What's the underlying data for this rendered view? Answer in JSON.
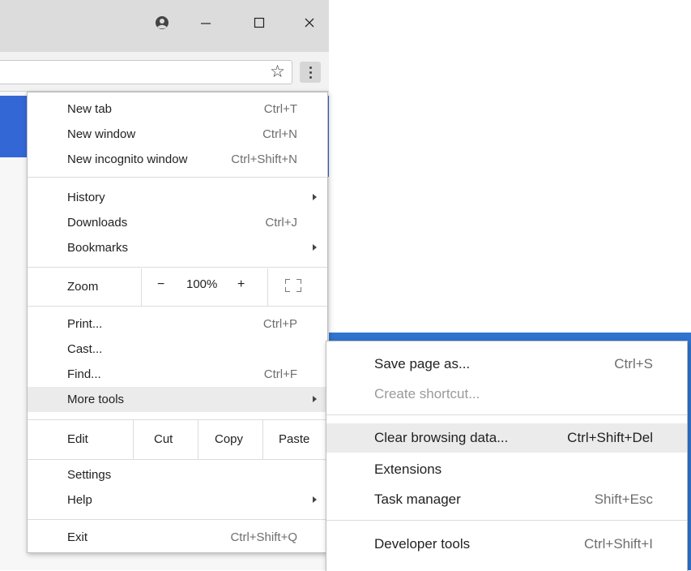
{
  "window_controls": {
    "profile_icon": "account-circle-icon",
    "minimize_icon": "minimize-icon",
    "maximize_icon": "maximize-icon",
    "close_icon": "close-icon"
  },
  "toolbar": {
    "bookmark_icon": "star-outline-icon",
    "menu_icon": "kebab-menu-icon"
  },
  "menu": {
    "group1": [
      {
        "label": "New tab",
        "shortcut": "Ctrl+T"
      },
      {
        "label": "New window",
        "shortcut": "Ctrl+N"
      },
      {
        "label": "New incognito window",
        "shortcut": "Ctrl+Shift+N"
      }
    ],
    "group2": [
      {
        "label": "History",
        "shortcut": ""
      },
      {
        "label": "Downloads",
        "shortcut": "Ctrl+J"
      },
      {
        "label": "Bookmarks",
        "shortcut": ""
      }
    ],
    "zoom": {
      "label": "Zoom",
      "minus": "−",
      "value": "100%",
      "plus": "+",
      "fullscreen_icon": "fullscreen-icon"
    },
    "group3": [
      {
        "label": "Print...",
        "shortcut": "Ctrl+P"
      },
      {
        "label": "Cast...",
        "shortcut": ""
      },
      {
        "label": "Find...",
        "shortcut": "Ctrl+F"
      },
      {
        "label": "More tools",
        "shortcut": ""
      }
    ],
    "edit": {
      "label": "Edit",
      "cut": "Cut",
      "copy": "Copy",
      "paste": "Paste"
    },
    "group4": [
      {
        "label": "Settings",
        "shortcut": ""
      },
      {
        "label": "Help",
        "shortcut": ""
      }
    ],
    "exit": {
      "label": "Exit",
      "shortcut": "Ctrl+Shift+Q"
    }
  },
  "submenu": {
    "items": [
      {
        "label": "Save page as...",
        "shortcut": "Ctrl+S"
      },
      {
        "label": "Create shortcut...",
        "shortcut": ""
      },
      {
        "label": "Clear browsing data...",
        "shortcut": "Ctrl+Shift+Del"
      },
      {
        "label": "Extensions",
        "shortcut": ""
      },
      {
        "label": "Task manager",
        "shortcut": "Shift+Esc"
      },
      {
        "label": "Developer tools",
        "shortcut": "Ctrl+Shift+I"
      }
    ]
  }
}
